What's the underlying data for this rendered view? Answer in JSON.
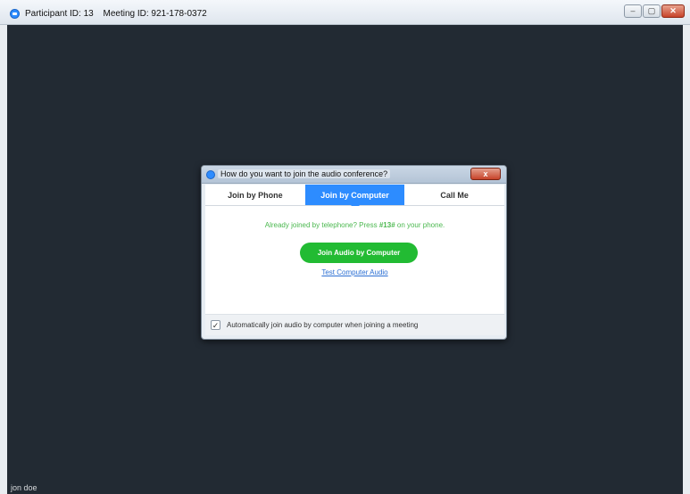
{
  "window": {
    "participant_id": "Participant ID: 13",
    "meeting_id": "Meeting ID: 921-178-0372",
    "minimize": "–",
    "restore": "▢",
    "close": "✕"
  },
  "stage": {
    "name": "jon doe"
  },
  "dialog": {
    "title": "How do you want to join the audio conference?",
    "close": "x",
    "tabs": [
      {
        "label": "Join by Phone"
      },
      {
        "label": "Join by Computer"
      },
      {
        "label": "Call Me"
      }
    ],
    "hint_prefix": "Already joined by telephone? Press ",
    "hint_code": "#13#",
    "hint_suffix": " on your phone.",
    "join_button": "Join Audio by Computer",
    "test_link": "Test Computer Audio",
    "auto_join_label": "Automatically join audio by computer when joining a meeting",
    "auto_join_check": "✓"
  },
  "colors": {
    "accent": "#2d8cff",
    "join_green": "#22bb33",
    "stage_bg": "#222a33"
  }
}
